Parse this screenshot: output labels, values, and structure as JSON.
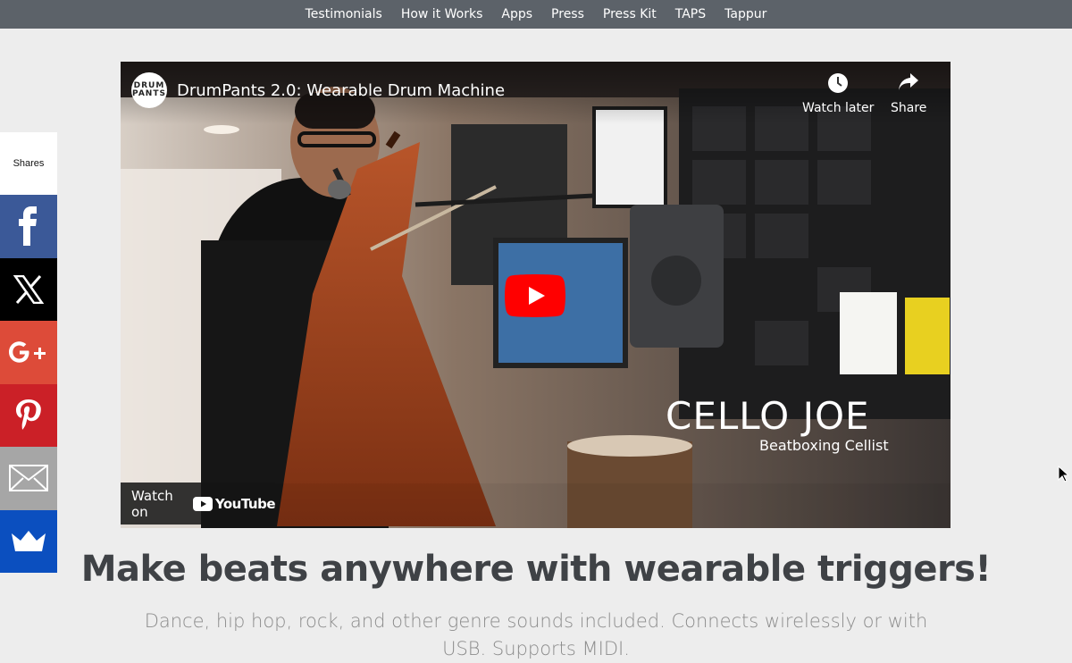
{
  "nav": {
    "items": [
      "Testimonials",
      "How it Works",
      "Apps",
      "Press",
      "Press Kit",
      "TAPS",
      "Tappur"
    ]
  },
  "share": {
    "label": "Shares",
    "buttons": [
      {
        "name": "facebook",
        "icon": "facebook-icon",
        "color": "#3b5998"
      },
      {
        "name": "x",
        "icon": "x-icon",
        "color": "#000000"
      },
      {
        "name": "google-plus",
        "icon": "google-plus-icon",
        "color": "#dd4b39"
      },
      {
        "name": "pinterest",
        "icon": "pinterest-icon",
        "color": "#cb2027"
      },
      {
        "name": "email",
        "icon": "email-icon",
        "color": "#a6a6a6"
      },
      {
        "name": "sumo",
        "icon": "crown-icon",
        "color": "#0b4fbf"
      }
    ]
  },
  "video": {
    "channel_logo": "DRUM PANTS",
    "title": "DrumPants 2.0: Wearable Drum Machine",
    "watch_later": "Watch later",
    "share": "Share",
    "overlay_title": "CELLO JOE",
    "overlay_subtitle": "Beatboxing Cellist",
    "watch_on": "Watch on",
    "youtube": "YouTube",
    "play_color": "#ff0000"
  },
  "main": {
    "headline": "Make beats anywhere with wearable triggers!",
    "subtext": "Dance, hip hop, rock, and other genre sounds included. Connects wirelessly or with USB. Supports MIDI."
  }
}
